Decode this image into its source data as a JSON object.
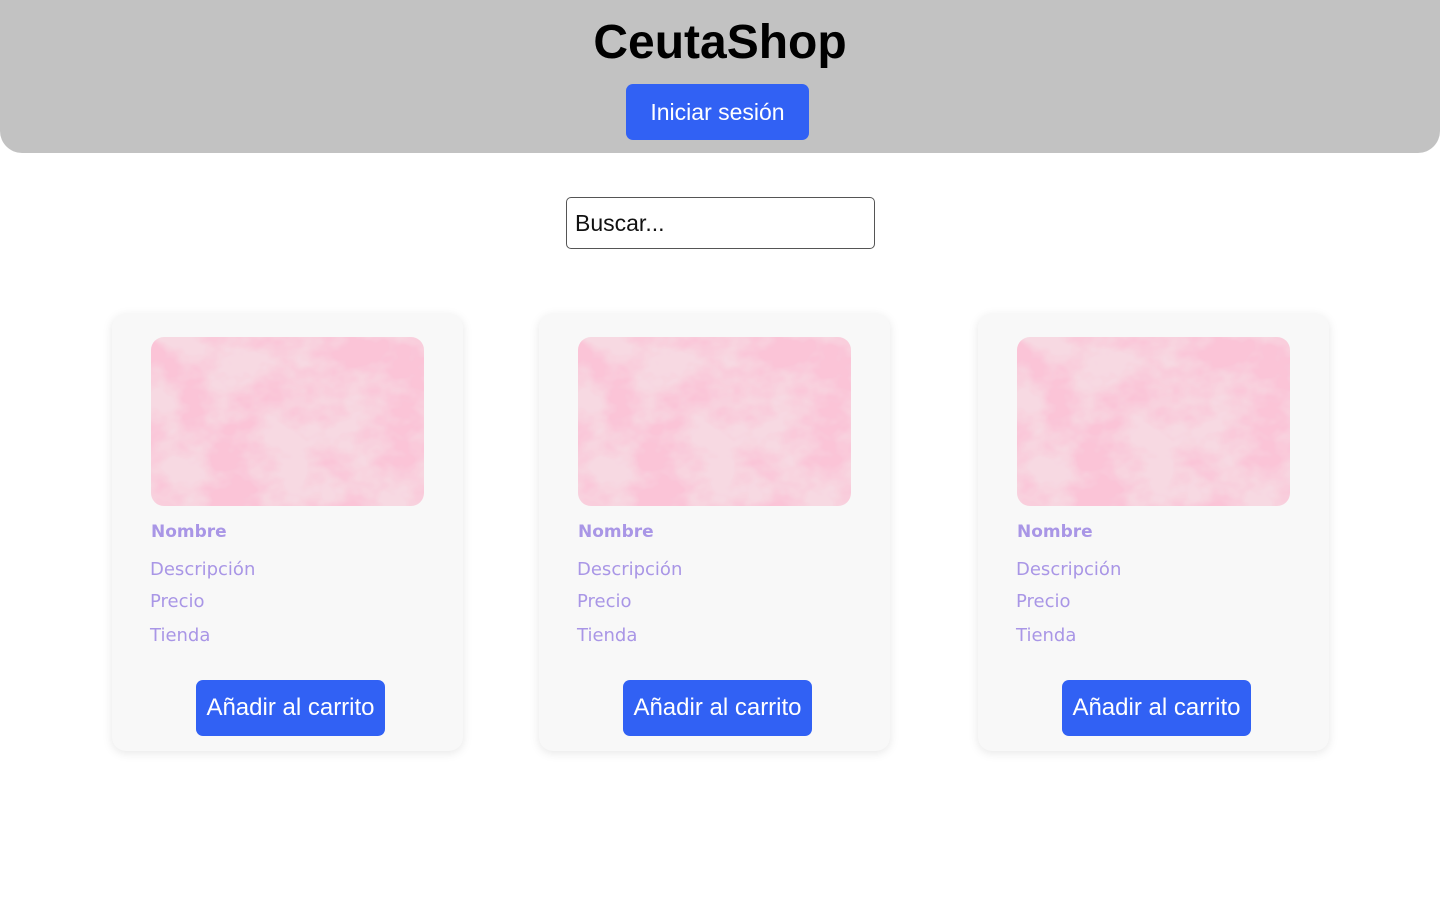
{
  "header": {
    "title": "CeutaShop",
    "login_label": "Iniciar sesión",
    "background_color": "#c2c2c2",
    "accent_color": "#3161f4"
  },
  "search": {
    "placeholder": "Buscar..."
  },
  "products": [
    {
      "image_icon": "pink-marble-image",
      "name": "Nombre",
      "description": "Descripción",
      "price": "Precio",
      "store": "Tienda",
      "add_label": "Añadir al carrito"
    },
    {
      "image_icon": "pink-marble-image",
      "name": "Nombre",
      "description": "Descripción",
      "price": "Precio",
      "store": "Tienda",
      "add_label": "Añadir al carrito"
    },
    {
      "image_icon": "pink-marble-image",
      "name": "Nombre",
      "description": "Descripción",
      "price": "Precio",
      "store": "Tienda",
      "add_label": "Añadir al carrito"
    }
  ],
  "colors": {
    "card_text": "#a996e6",
    "card_background": "#f8f8f8"
  }
}
